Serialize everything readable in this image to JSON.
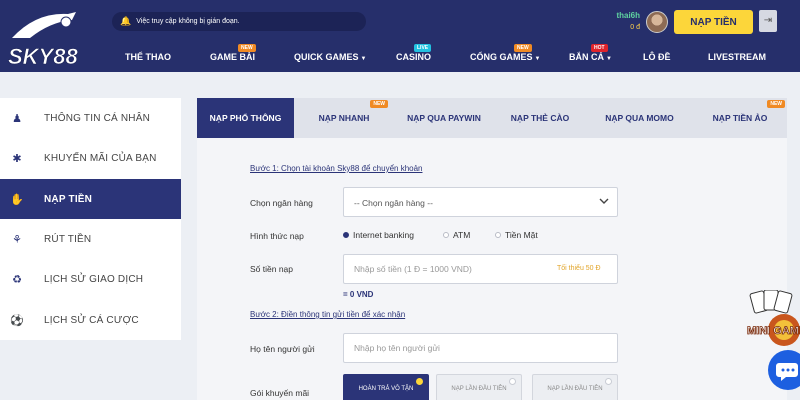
{
  "header": {
    "logo_text": "SKY88",
    "notice": "Việc truy cập không bị gián đoạn.",
    "user": {
      "name": "thai6h",
      "balance": "0 đ"
    },
    "deposit_button": "NẠP TIỀN",
    "logout_icon": "logout-icon"
  },
  "nav": {
    "items": [
      {
        "label": "THỂ THAO",
        "badge": ""
      },
      {
        "label": "GAME BÀI",
        "badge": "NEW"
      },
      {
        "label": "QUICK GAMES",
        "badge": ""
      },
      {
        "label": "CASINO",
        "badge": "LIVE"
      },
      {
        "label": "CỔNG GAMES",
        "badge": "NEW"
      },
      {
        "label": "BẮN CÁ",
        "badge": "HOT"
      },
      {
        "label": "LÔ ĐỀ",
        "badge": ""
      },
      {
        "label": "LIVESTREAM",
        "badge": ""
      }
    ]
  },
  "sidebar": {
    "items": [
      {
        "label": "THÔNG TIN CÁ NHÂN",
        "icon": "user-icon"
      },
      {
        "label": "KHUYẾN MÃI CỦA BẠN",
        "icon": "promotion-icon"
      },
      {
        "label": "NẠP TIỀN",
        "icon": "deposit-icon",
        "active": true
      },
      {
        "label": "RÚT TIỀN",
        "icon": "withdraw-icon"
      },
      {
        "label": "LỊCH SỬ GIAO DỊCH",
        "icon": "transaction-history-icon"
      },
      {
        "label": "LỊCH SỬ CÁ CƯỢC",
        "icon": "bet-history-icon"
      }
    ]
  },
  "tabs": [
    {
      "label": "NẠP PHỔ THÔNG",
      "badge": "",
      "active": true
    },
    {
      "label": "NẠP NHANH",
      "badge": "NEW"
    },
    {
      "label": "NẠP QUA PAYWIN",
      "badge": ""
    },
    {
      "label": "NẠP THẺ CÀO",
      "badge": ""
    },
    {
      "label": "NẠP QUA MOMO",
      "badge": ""
    },
    {
      "label": "NẠP TIỀN ẢO",
      "badge": "NEW"
    }
  ],
  "form": {
    "step1": "Bước 1: Chọn tài khoản Sky88 để chuyển khoản",
    "bank_label": "Chọn ngân hàng",
    "bank_select": "-- Chọn ngân hàng --",
    "method_label": "Hình thức nạp",
    "methods": [
      {
        "label": "Internet banking",
        "selected": true
      },
      {
        "label": "ATM",
        "selected": false
      },
      {
        "label": "Tiền Mặt",
        "selected": false
      }
    ],
    "amount_label": "Số tiền nạp",
    "amount_placeholder": "Nhập số tiền (1 Đ = 1000 VND)",
    "amount_min": "Tối thiểu 50 Đ",
    "amount_converted": "= 0 VND",
    "step2": "Bước 2: Điền thông tin gửi tiền để xác nhận",
    "sender_label": "Họ tên người gửi",
    "sender_placeholder": "Nhập họ tên người gửi",
    "promo_label": "Gói khuyến mãi",
    "promos": [
      {
        "label": "HOÀN TRẢ VÔ TẬN",
        "selected": true
      },
      {
        "label": "NẠP LẦN ĐẦU TIÊN",
        "selected": false
      },
      {
        "label": "NẠP LẦN ĐẦU TIÊN",
        "selected": false
      }
    ]
  },
  "widgets": {
    "mini_game_label": "MINI GAME",
    "chat_icon": "chat-icon"
  },
  "colors": {
    "header_bg": "#262f6b",
    "accent": "#fcd63a",
    "primary": "#2b3478",
    "badge_new": "#f08a24",
    "badge_live": "#22c1e0",
    "badge_hot": "#e0242b"
  }
}
